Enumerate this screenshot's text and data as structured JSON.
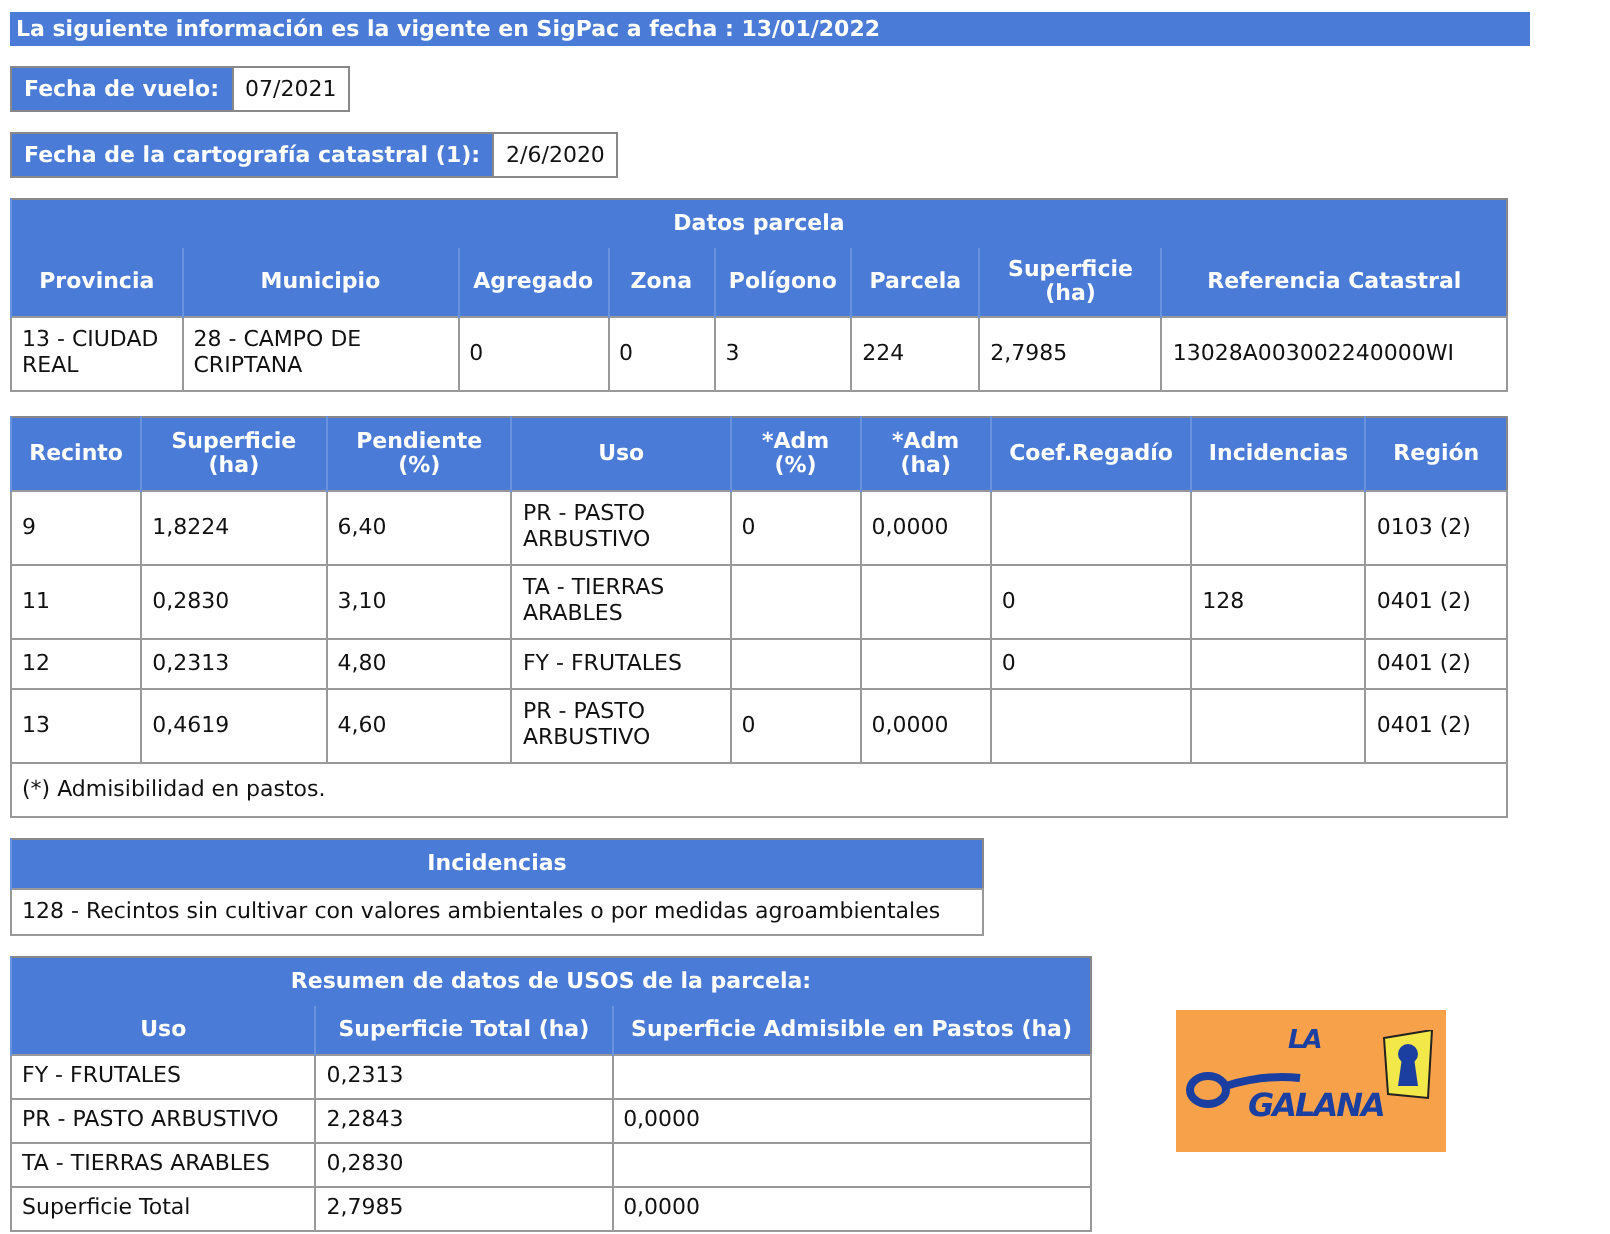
{
  "banner": "La siguiente información es la vigente en SigPac a fecha : 13/01/2022",
  "fields": [
    {
      "label": "Fecha de vuelo:",
      "value": "07/2021"
    },
    {
      "label": "Fecha de la cartografía catastral (1):",
      "value": "2/6/2020"
    }
  ],
  "parcel": {
    "title": "Datos parcela",
    "columns": [
      "Provincia",
      "Municipio",
      "Agregado",
      "Zona",
      "Polígono",
      "Parcela",
      "Superficie (ha)",
      "Referencia Catastral"
    ],
    "rows": [
      [
        "13 - CIUDAD REAL",
        "28 - CAMPO DE CRIPTANA",
        "0",
        "0",
        "3",
        "224",
        "2,7985",
        "13028A003002240000WI"
      ]
    ]
  },
  "enclosures": {
    "columns": [
      "Recinto",
      "Superficie (ha)",
      "Pendiente (%)",
      "Uso",
      "*Adm (%)",
      "*Adm (ha)",
      "Coef.Regadío",
      "Incidencias",
      "Región"
    ],
    "rows": [
      [
        "9",
        "1,8224",
        "6,40",
        "PR - PASTO ARBUSTIVO",
        "0",
        "0,0000",
        "",
        "",
        "0103 (2)"
      ],
      [
        "11",
        "0,2830",
        "3,10",
        "TA - TIERRAS ARABLES",
        "",
        "",
        "0",
        "128",
        "0401 (2)"
      ],
      [
        "12",
        "0,2313",
        "4,80",
        "FY - FRUTALES",
        "",
        "",
        "0",
        "",
        "0401 (2)"
      ],
      [
        "13",
        "0,4619",
        "4,60",
        "PR - PASTO ARBUSTIVO",
        "0",
        "0,0000",
        "",
        "",
        "0401 (2)"
      ]
    ],
    "footnote": "(*) Admisibilidad en pastos."
  },
  "incidents": {
    "title": "Incidencias",
    "items": [
      "128 - Recintos sin cultivar con valores ambientales o por medidas agroambientales"
    ]
  },
  "summary": {
    "title": "Resumen de datos de USOS de la parcela:",
    "columns": [
      "Uso",
      "Superficie Total (ha)",
      "Superficie Admisible en Pastos (ha)"
    ],
    "rows": [
      [
        "FY - FRUTALES",
        "0,2313",
        ""
      ],
      [
        "PR - PASTO ARBUSTIVO",
        "2,2843",
        "0,0000"
      ],
      [
        "TA - TIERRAS ARABLES",
        "0,2830",
        ""
      ],
      [
        "Superficie Total",
        "2,7985",
        "0,0000"
      ]
    ]
  },
  "logo": {
    "line_1": "LA",
    "line_2": "GALANA"
  }
}
